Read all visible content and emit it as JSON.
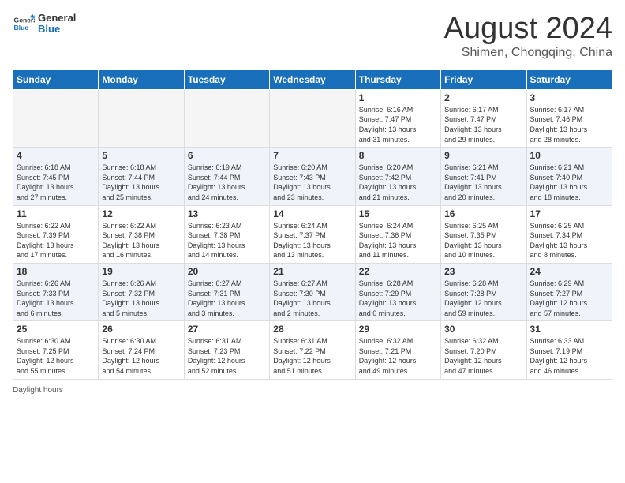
{
  "header": {
    "logo": {
      "general": "General",
      "blue": "Blue"
    },
    "month": "August 2024",
    "location": "Shimen, Chongqing, China"
  },
  "calendar": {
    "days_of_week": [
      "Sunday",
      "Monday",
      "Tuesday",
      "Wednesday",
      "Thursday",
      "Friday",
      "Saturday"
    ],
    "rows": [
      {
        "cells": [
          {
            "empty": true
          },
          {
            "empty": true
          },
          {
            "empty": true
          },
          {
            "empty": true
          },
          {
            "day": "1",
            "info": "Sunrise: 6:16 AM\nSunset: 7:47 PM\nDaylight: 13 hours\nand 31 minutes."
          },
          {
            "day": "2",
            "info": "Sunrise: 6:17 AM\nSunset: 7:47 PM\nDaylight: 13 hours\nand 29 minutes."
          },
          {
            "day": "3",
            "info": "Sunrise: 6:17 AM\nSunset: 7:46 PM\nDaylight: 13 hours\nand 28 minutes."
          }
        ]
      },
      {
        "cells": [
          {
            "day": "4",
            "info": "Sunrise: 6:18 AM\nSunset: 7:45 PM\nDaylight: 13 hours\nand 27 minutes."
          },
          {
            "day": "5",
            "info": "Sunrise: 6:18 AM\nSunset: 7:44 PM\nDaylight: 13 hours\nand 25 minutes."
          },
          {
            "day": "6",
            "info": "Sunrise: 6:19 AM\nSunset: 7:44 PM\nDaylight: 13 hours\nand 24 minutes."
          },
          {
            "day": "7",
            "info": "Sunrise: 6:20 AM\nSunset: 7:43 PM\nDaylight: 13 hours\nand 23 minutes."
          },
          {
            "day": "8",
            "info": "Sunrise: 6:20 AM\nSunset: 7:42 PM\nDaylight: 13 hours\nand 21 minutes."
          },
          {
            "day": "9",
            "info": "Sunrise: 6:21 AM\nSunset: 7:41 PM\nDaylight: 13 hours\nand 20 minutes."
          },
          {
            "day": "10",
            "info": "Sunrise: 6:21 AM\nSunset: 7:40 PM\nDaylight: 13 hours\nand 18 minutes."
          }
        ]
      },
      {
        "cells": [
          {
            "day": "11",
            "info": "Sunrise: 6:22 AM\nSunset: 7:39 PM\nDaylight: 13 hours\nand 17 minutes."
          },
          {
            "day": "12",
            "info": "Sunrise: 6:22 AM\nSunset: 7:38 PM\nDaylight: 13 hours\nand 16 minutes."
          },
          {
            "day": "13",
            "info": "Sunrise: 6:23 AM\nSunset: 7:38 PM\nDaylight: 13 hours\nand 14 minutes."
          },
          {
            "day": "14",
            "info": "Sunrise: 6:24 AM\nSunset: 7:37 PM\nDaylight: 13 hours\nand 13 minutes."
          },
          {
            "day": "15",
            "info": "Sunrise: 6:24 AM\nSunset: 7:36 PM\nDaylight: 13 hours\nand 11 minutes."
          },
          {
            "day": "16",
            "info": "Sunrise: 6:25 AM\nSunset: 7:35 PM\nDaylight: 13 hours\nand 10 minutes."
          },
          {
            "day": "17",
            "info": "Sunrise: 6:25 AM\nSunset: 7:34 PM\nDaylight: 13 hours\nand 8 minutes."
          }
        ]
      },
      {
        "cells": [
          {
            "day": "18",
            "info": "Sunrise: 6:26 AM\nSunset: 7:33 PM\nDaylight: 13 hours\nand 6 minutes."
          },
          {
            "day": "19",
            "info": "Sunrise: 6:26 AM\nSunset: 7:32 PM\nDaylight: 13 hours\nand 5 minutes."
          },
          {
            "day": "20",
            "info": "Sunrise: 6:27 AM\nSunset: 7:31 PM\nDaylight: 13 hours\nand 3 minutes."
          },
          {
            "day": "21",
            "info": "Sunrise: 6:27 AM\nSunset: 7:30 PM\nDaylight: 13 hours\nand 2 minutes."
          },
          {
            "day": "22",
            "info": "Sunrise: 6:28 AM\nSunset: 7:29 PM\nDaylight: 13 hours\nand 0 minutes."
          },
          {
            "day": "23",
            "info": "Sunrise: 6:28 AM\nSunset: 7:28 PM\nDaylight: 12 hours\nand 59 minutes."
          },
          {
            "day": "24",
            "info": "Sunrise: 6:29 AM\nSunset: 7:27 PM\nDaylight: 12 hours\nand 57 minutes."
          }
        ]
      },
      {
        "cells": [
          {
            "day": "25",
            "info": "Sunrise: 6:30 AM\nSunset: 7:25 PM\nDaylight: 12 hours\nand 55 minutes."
          },
          {
            "day": "26",
            "info": "Sunrise: 6:30 AM\nSunset: 7:24 PM\nDaylight: 12 hours\nand 54 minutes."
          },
          {
            "day": "27",
            "info": "Sunrise: 6:31 AM\nSunset: 7:23 PM\nDaylight: 12 hours\nand 52 minutes."
          },
          {
            "day": "28",
            "info": "Sunrise: 6:31 AM\nSunset: 7:22 PM\nDaylight: 12 hours\nand 51 minutes."
          },
          {
            "day": "29",
            "info": "Sunrise: 6:32 AM\nSunset: 7:21 PM\nDaylight: 12 hours\nand 49 minutes."
          },
          {
            "day": "30",
            "info": "Sunrise: 6:32 AM\nSunset: 7:20 PM\nDaylight: 12 hours\nand 47 minutes."
          },
          {
            "day": "31",
            "info": "Sunrise: 6:33 AM\nSunset: 7:19 PM\nDaylight: 12 hours\nand 46 minutes."
          }
        ]
      }
    ]
  },
  "footer": {
    "note": "Daylight hours"
  }
}
